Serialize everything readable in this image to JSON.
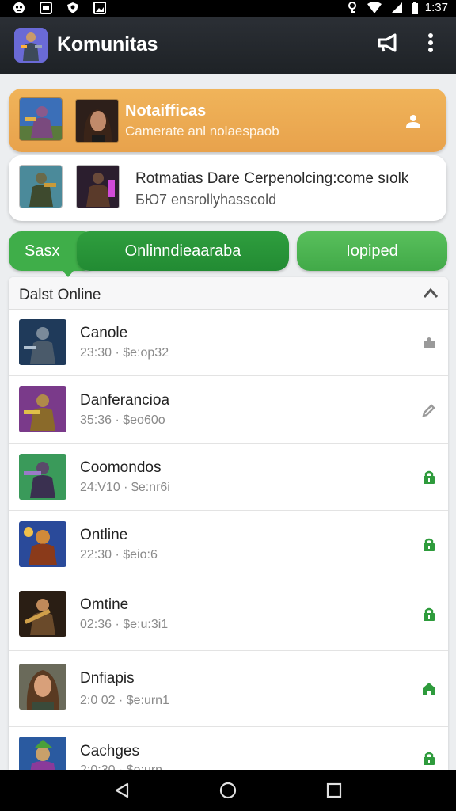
{
  "status_bar": {
    "time": "1:37",
    "icons": [
      "notification-icon",
      "gallery-icon",
      "shield-icon",
      "photo-icon",
      "key-icon",
      "wifi-icon",
      "signal-icon",
      "battery-icon"
    ]
  },
  "app_bar": {
    "title": "Komunitas",
    "actions": [
      "megaphone-icon",
      "more-vert-icon"
    ]
  },
  "notifications": [
    {
      "title": "Notaifficas",
      "subtitle": "Camerate anl nolaespaob",
      "style": "orange",
      "accent": "#e9a64f",
      "action_icon": "user-icon"
    },
    {
      "title": "Rotmatias Dare Cerpenolcing:come sıolk",
      "subtitle": "БЮ7 ensrollyhasscold",
      "style": "white"
    }
  ],
  "pills": [
    {
      "label": "Sasx"
    },
    {
      "label": "Onlinndieaaraba"
    },
    {
      "label": "Iopiped"
    }
  ],
  "list": {
    "header": "Dalst Online",
    "rows": [
      {
        "name": "Canole",
        "meta": "23:30 · $e:op32",
        "status_icon": "puzzle-icon",
        "status_color": "#9a9a9a"
      },
      {
        "name": "Danferancioa",
        "meta": "35:36 · $eo60o",
        "status_icon": "edit-icon",
        "status_color": "#9a9a9a"
      },
      {
        "name": "Coomondos",
        "meta": "24:V10 · $e:nr6i",
        "status_icon": "lock-icon",
        "status_color": "#2e9b3c"
      },
      {
        "name": "Ontline",
        "meta": "22:30 · $eio:6",
        "status_icon": "lock-icon",
        "status_color": "#2e9b3c"
      },
      {
        "name": "Omtine",
        "meta": "02:36 · $e:u:3i1",
        "status_icon": "lock-icon",
        "status_color": "#2e9b3c"
      },
      {
        "name": "Dnfiapis",
        "meta": "2:0 02 · $e:urn1",
        "status_icon": "home-icon",
        "status_color": "#2e9b3c"
      },
      {
        "name": "Cachges",
        "meta": "2:0:30 · $e:urn",
        "status_icon": "lock-icon",
        "status_color": "#2e9b3c"
      }
    ]
  },
  "nav_bar": [
    "back-icon",
    "home-circle-icon",
    "recents-icon"
  ]
}
